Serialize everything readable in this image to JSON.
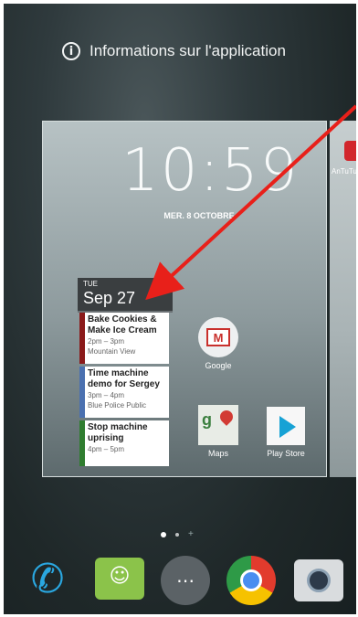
{
  "info_bar": {
    "label": "Informations sur l'application",
    "icon": "info-icon"
  },
  "lockscreen": {
    "time": "10:59",
    "date": "MER. 8 OCTOBRE"
  },
  "calendar_widget": {
    "day_of_week": "TUE",
    "date": "Sep 27",
    "events": [
      {
        "title": "Bake Cookies &",
        "title2": "Make Ice Cream",
        "time": "2pm – 3pm",
        "location": "Mountain View",
        "color": "#8b1a1a"
      },
      {
        "title": "Time machine",
        "title2": "demo for Sergey",
        "time": "3pm – 4pm",
        "location": "Blue Police Public",
        "color": "#4a70b0"
      },
      {
        "title": "Stop machine",
        "title2": "uprising",
        "time": "4pm – 5pm",
        "location": "",
        "color": "#2f7d2f"
      }
    ]
  },
  "apps": {
    "google": {
      "label": "Google",
      "icon": "gmail-icon"
    },
    "maps": {
      "label": "Maps",
      "icon": "maps-icon"
    },
    "play_store": {
      "label": "Play Store",
      "icon": "play-store-icon"
    },
    "antutu": {
      "label": "AnTuTu",
      "icon": "antutu-icon"
    }
  },
  "annotation": {
    "color": "#e8201a"
  },
  "dock": {
    "items": [
      {
        "name": "phone",
        "icon": "phone-icon"
      },
      {
        "name": "messaging",
        "icon": "messaging-icon"
      },
      {
        "name": "all-apps",
        "icon": "app-drawer-icon"
      },
      {
        "name": "chrome",
        "icon": "chrome-icon"
      },
      {
        "name": "camera",
        "icon": "camera-icon"
      }
    ]
  }
}
